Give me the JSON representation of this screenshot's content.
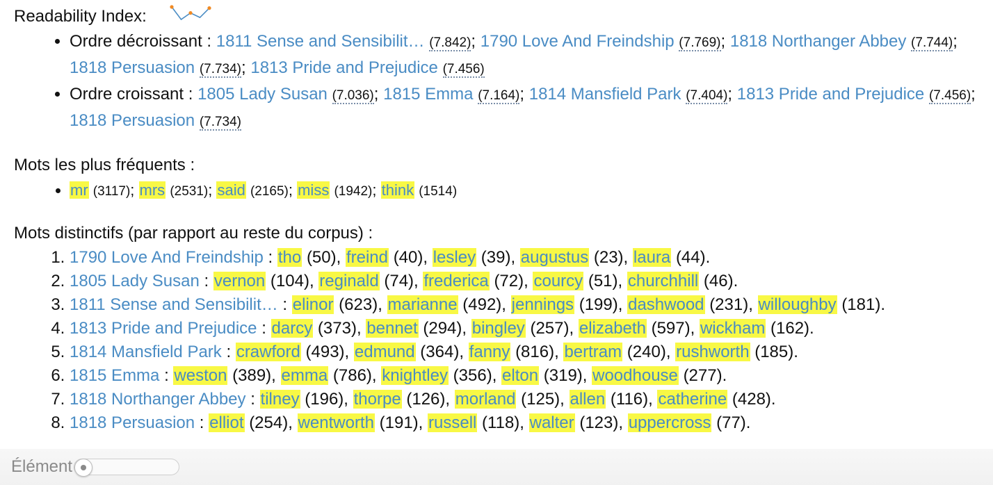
{
  "readability": {
    "title": "Readability Index:",
    "sparkline_color": "#4a8cc4",
    "sparkline_points": [
      7.842,
      7.036,
      7.456,
      7.164,
      7.769
    ],
    "decreasing": {
      "label": "Ordre décroissant :",
      "items": [
        {
          "doc": "1811 Sense and Sensibilit…",
          "score": "(7.842)"
        },
        {
          "doc": "1790 Love And Freindship",
          "score": "(7.769)"
        },
        {
          "doc": "1818 Northanger Abbey",
          "score": "(7.744)"
        },
        {
          "doc": "1818 Persuasion",
          "score": "(7.734)"
        },
        {
          "doc": "1813 Pride and Prejudice",
          "score": "(7.456)"
        }
      ]
    },
    "increasing": {
      "label": "Ordre croissant :",
      "items": [
        {
          "doc": "1805 Lady Susan",
          "score": "(7.036)"
        },
        {
          "doc": "1815 Emma",
          "score": "(7.164)"
        },
        {
          "doc": "1814 Mansfield Park",
          "score": "(7.404)"
        },
        {
          "doc": "1813 Pride and Prejudice",
          "score": "(7.456)"
        },
        {
          "doc": "1818 Persuasion",
          "score": "(7.734)"
        }
      ]
    }
  },
  "frequent": {
    "title": "Mots les plus fréquents :",
    "words": [
      {
        "word": "mr",
        "count": "(3117)"
      },
      {
        "word": "mrs",
        "count": "(2531)"
      },
      {
        "word": "said",
        "count": "(2165)"
      },
      {
        "word": "miss",
        "count": "(1942)"
      },
      {
        "word": "think",
        "count": "(1514)"
      }
    ]
  },
  "distinctive": {
    "title": "Mots distinctifs (par rapport au reste du corpus) :",
    "docs": [
      {
        "doc": "1790 Love And Freindship",
        "words": [
          [
            "tho",
            "(50)"
          ],
          [
            "freind",
            "(40)"
          ],
          [
            "lesley",
            "(39)"
          ],
          [
            "augustus",
            "(23)"
          ],
          [
            "laura",
            "(44)"
          ]
        ]
      },
      {
        "doc": "1805 Lady Susan",
        "words": [
          [
            "vernon",
            "(104)"
          ],
          [
            "reginald",
            "(74)"
          ],
          [
            "frederica",
            "(72)"
          ],
          [
            "courcy",
            "(51)"
          ],
          [
            "churchhill",
            "(46)"
          ]
        ]
      },
      {
        "doc": "1811 Sense and Sensibilit…",
        "words": [
          [
            "elinor",
            "(623)"
          ],
          [
            "marianne",
            "(492)"
          ],
          [
            "jennings",
            "(199)"
          ],
          [
            "dashwood",
            "(231)"
          ],
          [
            "willoughby",
            "(181)"
          ]
        ]
      },
      {
        "doc": "1813 Pride and Prejudice",
        "words": [
          [
            "darcy",
            "(373)"
          ],
          [
            "bennet",
            "(294)"
          ],
          [
            "bingley",
            "(257)"
          ],
          [
            "elizabeth",
            "(597)"
          ],
          [
            "wickham",
            "(162)"
          ]
        ]
      },
      {
        "doc": "1814 Mansfield Park",
        "words": [
          [
            "crawford",
            "(493)"
          ],
          [
            "edmund",
            "(364)"
          ],
          [
            "fanny",
            "(816)"
          ],
          [
            "bertram",
            "(240)"
          ],
          [
            "rushworth",
            "(185)"
          ]
        ]
      },
      {
        "doc": "1815 Emma",
        "words": [
          [
            "weston",
            "(389)"
          ],
          [
            "emma",
            "(786)"
          ],
          [
            "knightley",
            "(356)"
          ],
          [
            "elton",
            "(319)"
          ],
          [
            "woodhouse",
            "(277)"
          ]
        ]
      },
      {
        "doc": "1818 Northanger Abbey",
        "words": [
          [
            "tilney",
            "(196)"
          ],
          [
            "thorpe",
            "(126)"
          ],
          [
            "morland",
            "(125)"
          ],
          [
            "allen",
            "(116)"
          ],
          [
            "catherine",
            "(428)"
          ]
        ]
      },
      {
        "doc": "1818 Persuasion",
        "words": [
          [
            "elliot",
            "(254)"
          ],
          [
            "wentworth",
            "(191)"
          ],
          [
            "russell",
            "(118)"
          ],
          [
            "walter",
            "(123)"
          ],
          [
            "uppercross",
            "(77)"
          ]
        ]
      }
    ]
  },
  "footer": {
    "label": "Élément",
    "slider_value": 0
  }
}
